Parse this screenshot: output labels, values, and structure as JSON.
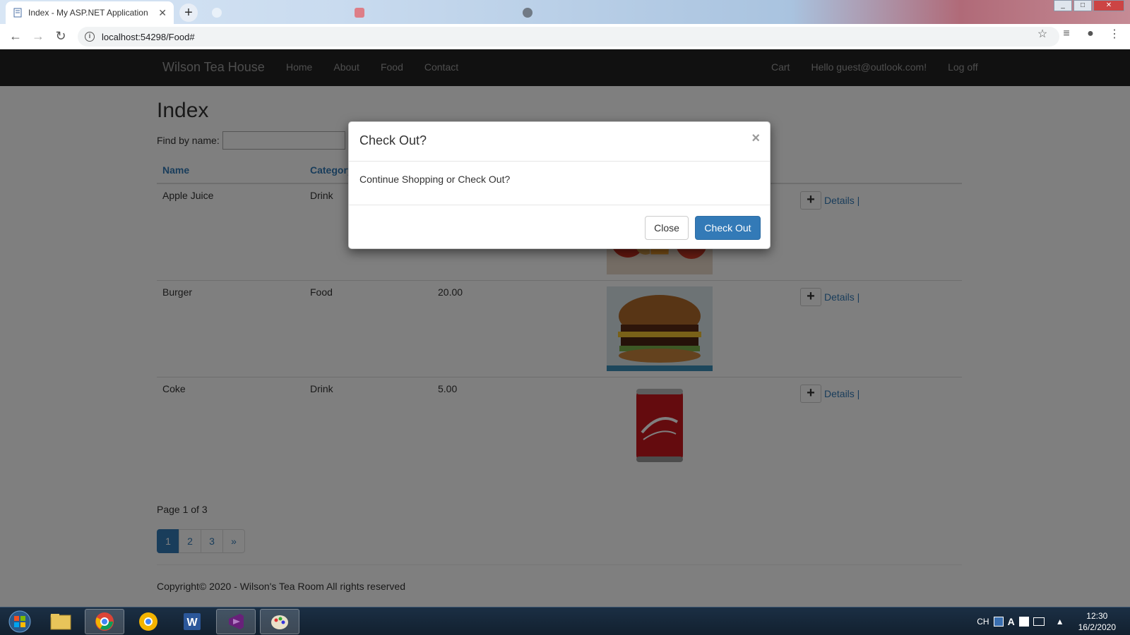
{
  "browser": {
    "tabs": [
      {
        "title": "Index - My ASP.NET Application",
        "active": true
      },
      {
        "title": "",
        "active": false
      },
      {
        "title": "",
        "active": false
      }
    ],
    "url": "localhost:54298/Food#"
  },
  "site": {
    "brand": "Wilson Tea House",
    "nav_left": [
      "Home",
      "About",
      "Food",
      "Contact"
    ],
    "nav_right": [
      "Cart",
      "Hello guest@outlook.com!",
      "Log off"
    ]
  },
  "main": {
    "heading": "Index",
    "find_label": "Find by name:",
    "search_value": "",
    "columns": [
      "Name",
      "Category"
    ],
    "rows": [
      {
        "name": "Apple Juice",
        "category": "Drink",
        "price": "",
        "image": "apple-juice",
        "details": "Details |"
      },
      {
        "name": "Burger",
        "category": "Food",
        "price": "20.00",
        "image": "burger",
        "details": "Details |"
      },
      {
        "name": "Coke",
        "category": "Drink",
        "price": "5.00",
        "image": "coke-can",
        "details": "Details |"
      }
    ],
    "page_text": "Page 1 of 3",
    "pages": [
      "1",
      "2",
      "3",
      "»"
    ],
    "footer": "Copyright© 2020 - Wilson's Tea Room All rights reserved"
  },
  "modal": {
    "title": "Check Out?",
    "close_x": "×",
    "body": "Continue Shopping or Check Out?",
    "close_label": "Close",
    "checkout_label": "Check Out"
  },
  "taskbar": {
    "lang": "CH",
    "time": "12:30",
    "date": "16/2/2020"
  },
  "colors": {
    "navbar": "#222222",
    "link": "#337ab7",
    "primary": "#337ab7"
  }
}
